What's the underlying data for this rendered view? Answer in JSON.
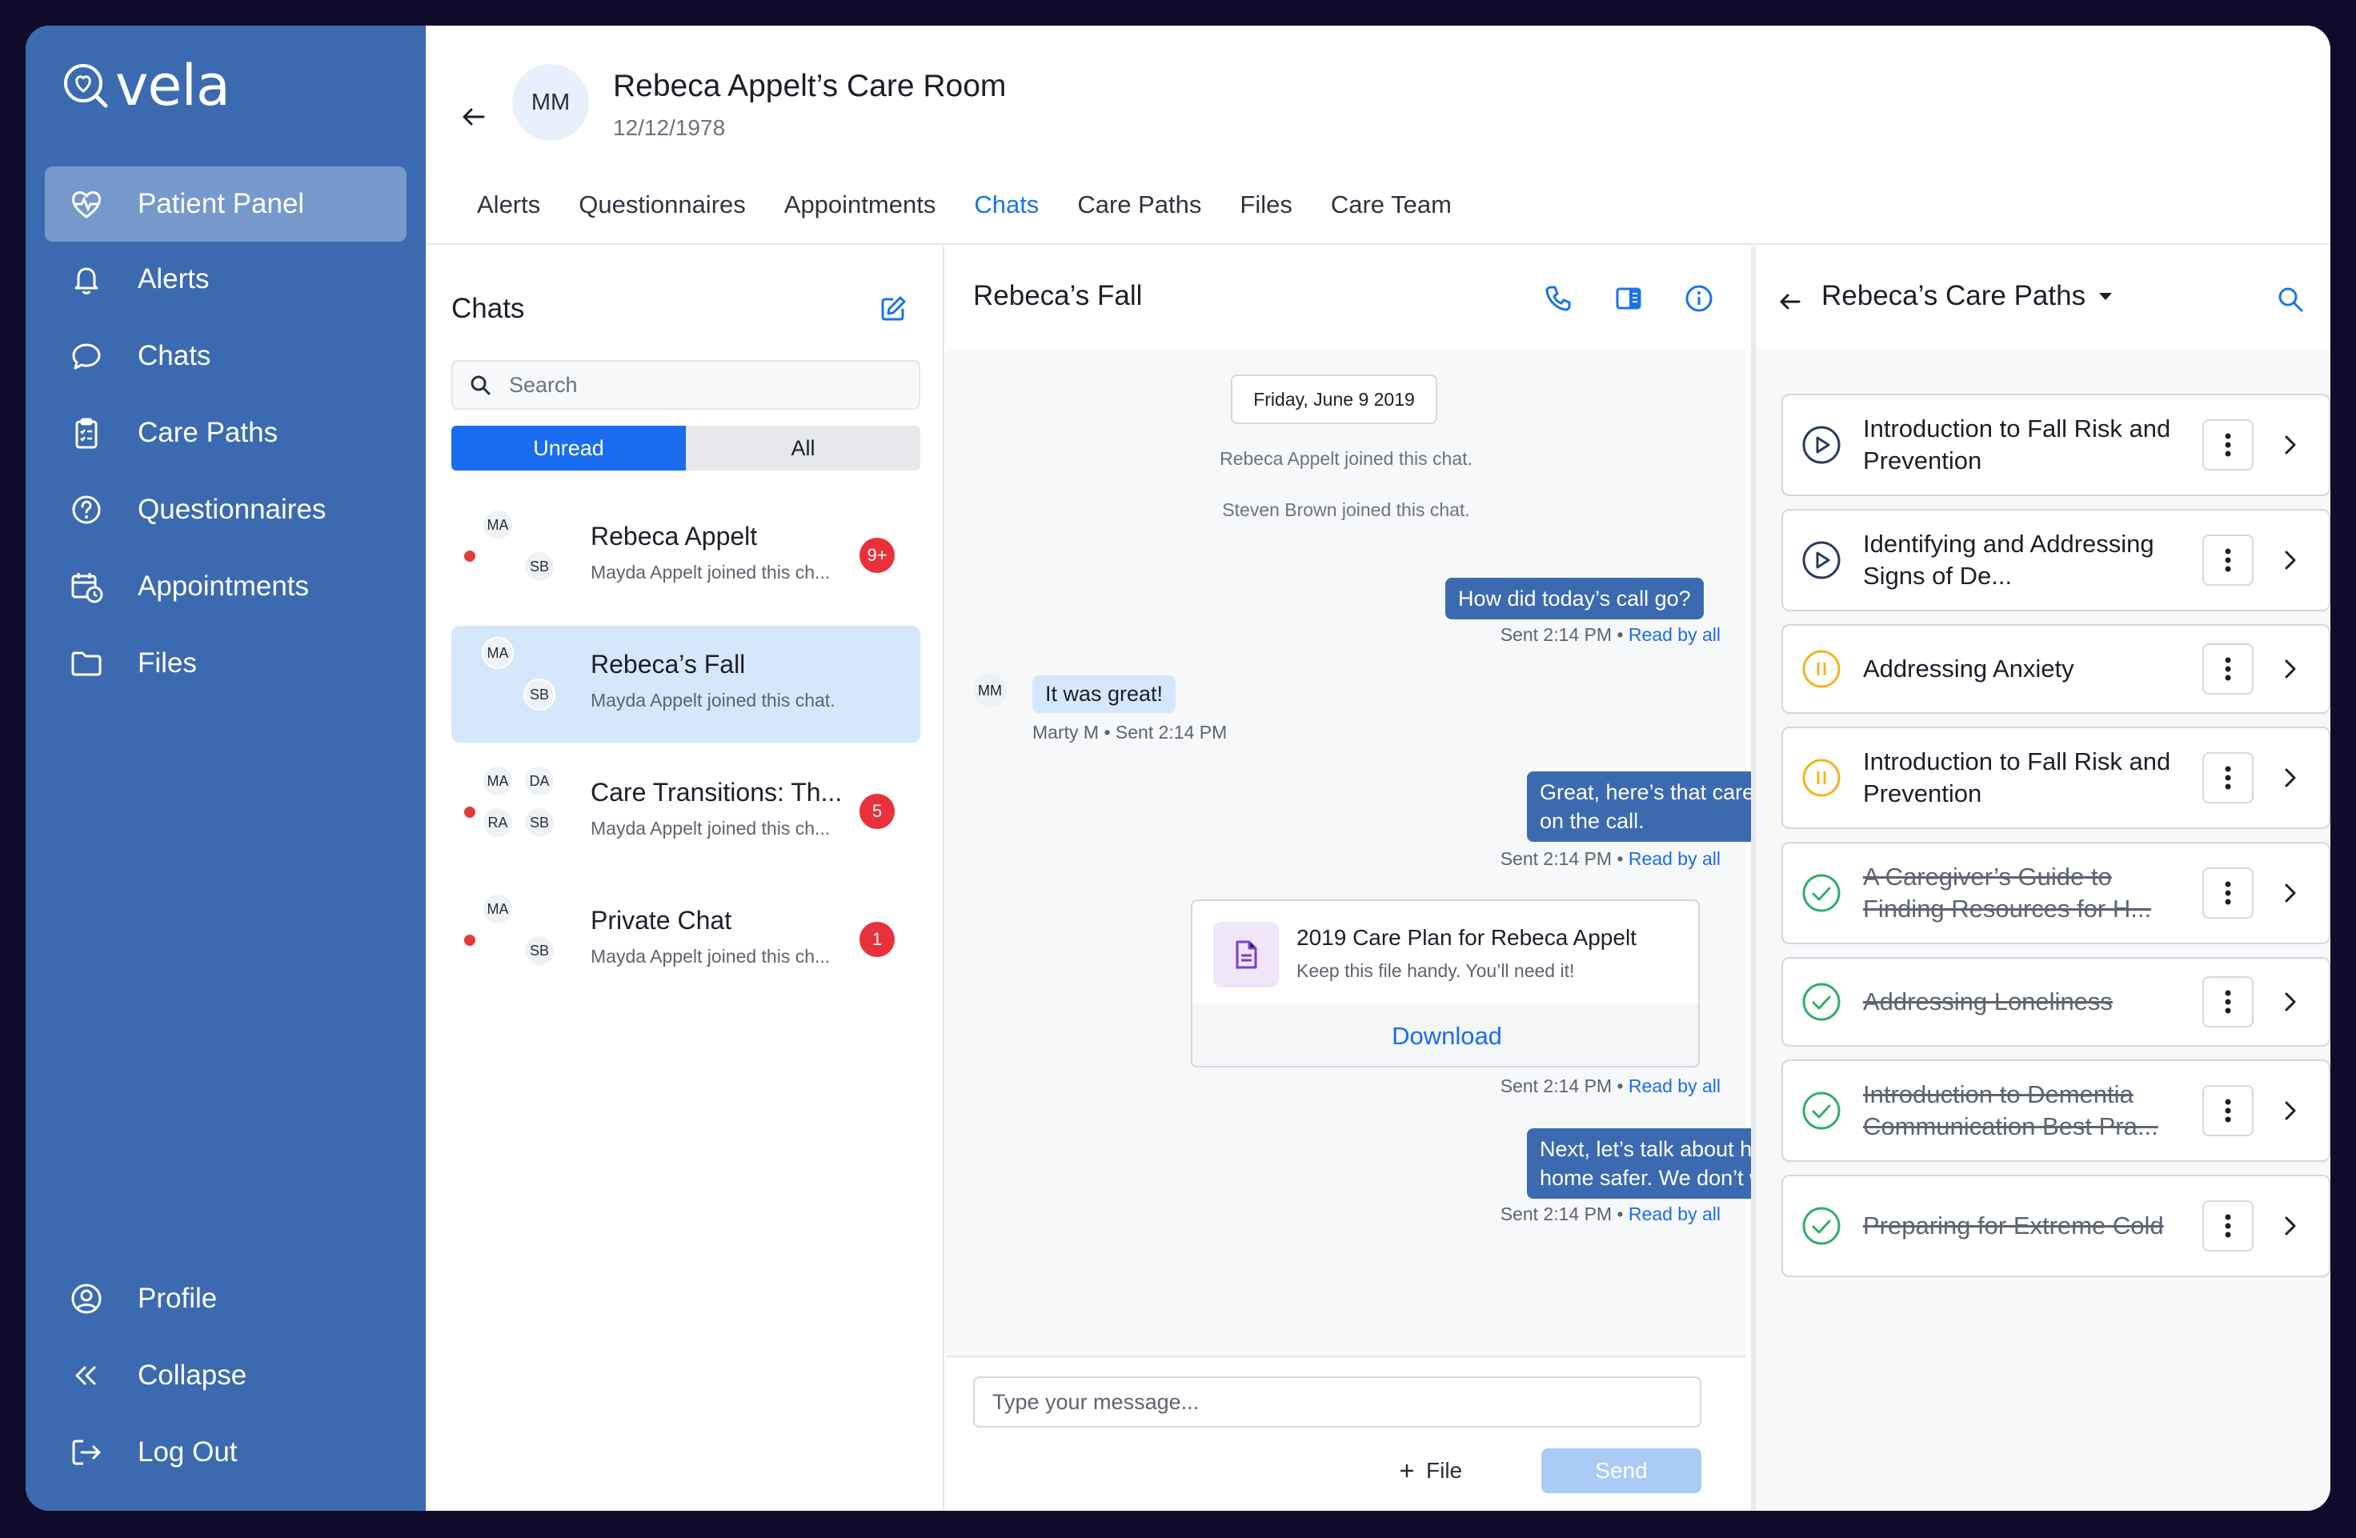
{
  "app": {
    "logo": "vela"
  },
  "sidebar": {
    "items": [
      {
        "label": "Patient Panel",
        "icon": "heart-pulse-icon",
        "active": true
      },
      {
        "label": "Alerts",
        "icon": "bell-icon"
      },
      {
        "label": "Chats",
        "icon": "chat-bubble-icon"
      },
      {
        "label": "Care Paths",
        "icon": "clipboard-icon"
      },
      {
        "label": "Questionnaires",
        "icon": "question-circle-icon"
      },
      {
        "label": "Appointments",
        "icon": "calendar-clock-icon"
      },
      {
        "label": "Files",
        "icon": "folder-icon"
      }
    ],
    "bottom": [
      {
        "label": "Profile",
        "icon": "user-circle-icon"
      },
      {
        "label": "Collapse",
        "icon": "double-chevron-left-icon"
      },
      {
        "label": "Log Out",
        "icon": "logout-icon"
      }
    ]
  },
  "header": {
    "avatar": "MM",
    "title": "Rebeca Appelt’s Care Room",
    "dob": "12/12/1978",
    "tabs": [
      "Alerts",
      "Questionnaires",
      "Appointments",
      "Chats",
      "Care Paths",
      "Files",
      "Care Team"
    ],
    "active_tab": "Chats"
  },
  "chat_list": {
    "title": "Chats",
    "search_placeholder": "Search",
    "filters": {
      "unread": "Unread",
      "all": "All"
    },
    "items": [
      {
        "name": "Rebeca Appelt",
        "preview": "Mayda Appelt joined this ch...",
        "badge": "9+",
        "avatars": [
          "MA",
          "SB"
        ]
      },
      {
        "name": "Rebeca’s Fall",
        "preview": "Mayda Appelt joined this chat.",
        "avatars": [
          "MA",
          "SB"
        ]
      },
      {
        "name": "Care Transitions: Th...",
        "preview": "Mayda Appelt joined this ch...",
        "badge": "5",
        "avatars": [
          "MA",
          "DA",
          "RA",
          "SB"
        ]
      },
      {
        "name": "Private Chat",
        "preview": "Mayda Appelt joined this ch...",
        "badge": "1",
        "avatars": [
          "MA",
          "SB"
        ]
      }
    ]
  },
  "conversation": {
    "title": "Rebeca’s Fall",
    "date_chip": "Friday, June 9 2019",
    "system": [
      "Rebeca Appelt joined this chat.",
      "Steven Brown joined this chat."
    ],
    "messages": {
      "m1": "How did today’s call go?",
      "m2": "It was great!",
      "m2_author": "Marty M",
      "m2_time": "Sent 2:14 PM",
      "m2_avatar": "MM",
      "m3": "Great, here’s that care plan that we talked about on the call.",
      "m5": "Next, let’s talk about how we can make your home safer. We don’t want you to fall."
    },
    "sent_meta": "Sent 2:14 PM",
    "read_by": "Read by all",
    "bullet": "•",
    "file": {
      "title": "2019 Care Plan for Rebeca Appelt",
      "subtitle": "Keep this file handy. You’ll need it!",
      "action": "Download"
    },
    "composer": {
      "placeholder": "Type your message...",
      "file_label": "File",
      "send_label": "Send"
    }
  },
  "care_paths": {
    "title": "Rebeca’s Care Paths",
    "items": [
      {
        "title": "Introduction to Fall Risk and Prevention",
        "status": "play"
      },
      {
        "title": "Identifying and Addressing Signs of De...",
        "status": "play"
      },
      {
        "title": "Addressing Anxiety",
        "status": "paused"
      },
      {
        "title": "Introduction to Fall Risk and Prevention",
        "status": "paused"
      },
      {
        "title": "A Caregiver’s Guide to Finding Resources for H...",
        "status": "done"
      },
      {
        "title": "Addressing Loneliness",
        "status": "done"
      },
      {
        "title": "Introduction to Dementia Communication Best Pra...",
        "status": "done"
      },
      {
        "title": "Preparing for Extreme Cold",
        "status": "done"
      }
    ]
  },
  "colors": {
    "sidebar": "#3b6ab1",
    "accent": "#1a73e8",
    "badge": "#e8313a",
    "paused": "#f2b51f",
    "done": "#2fae6f"
  }
}
